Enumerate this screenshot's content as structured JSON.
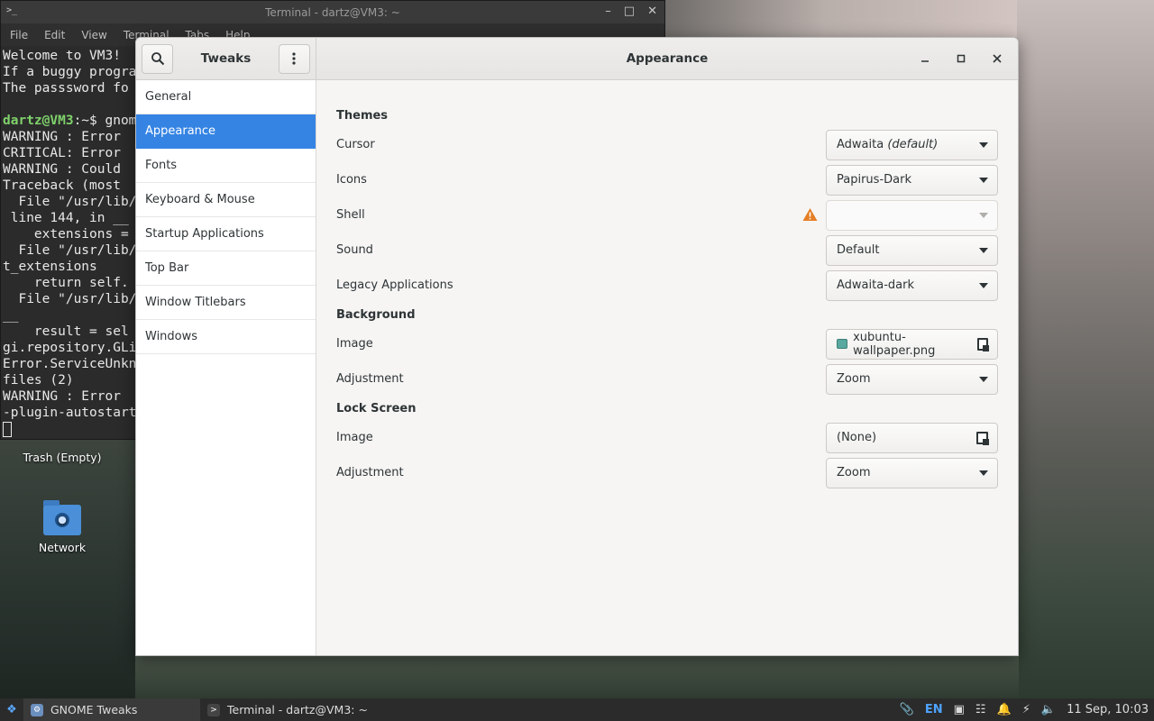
{
  "terminal": {
    "title": "Terminal - dartz@VM3: ~",
    "menu": [
      "File",
      "Edit",
      "View",
      "Terminal",
      "Tabs",
      "Help"
    ],
    "lines": [
      {
        "text": "Welcome to VM3!"
      },
      {
        "text": "If a buggy progra"
      },
      {
        "text": "The passsword fo"
      },
      {
        "text": ""
      },
      {
        "prompt": "dartz@VM3",
        "text": ":~$ gnom"
      },
      {
        "text": "WARNING : Error"
      },
      {
        "text": "CRITICAL: Error"
      },
      {
        "text": "WARNING : Could"
      },
      {
        "text": "Traceback (most"
      },
      {
        "text": "  File \"/usr/lib/"
      },
      {
        "text": " line 144, in __"
      },
      {
        "text": "    extensions ="
      },
      {
        "text": "  File \"/usr/lib/"
      },
      {
        "text": "t_extensions"
      },
      {
        "text": "    return self."
      },
      {
        "text": "  File \"/usr/lib/"
      },
      {
        "text": "__"
      },
      {
        "text": "    result = sel"
      },
      {
        "text": "gi.repository.GLi"
      },
      {
        "text": "Error.ServiceUnkn"
      },
      {
        "text": "files (2)"
      },
      {
        "text": "WARNING : Error"
      },
      {
        "text": "-plugin-autostart"
      }
    ]
  },
  "desktop": {
    "trash_label": "Trash (Empty)",
    "network_label": "Network"
  },
  "tweaks": {
    "sidebar_title": "Tweaks",
    "main_title": "Appearance",
    "sidebar_items": [
      {
        "label": "General",
        "active": false
      },
      {
        "label": "Appearance",
        "active": true
      },
      {
        "label": "Fonts",
        "active": false
      },
      {
        "label": "Keyboard & Mouse",
        "active": false
      },
      {
        "label": "Startup Applications",
        "active": false
      },
      {
        "label": "Top Bar",
        "active": false
      },
      {
        "label": "Window Titlebars",
        "active": false
      },
      {
        "label": "Windows",
        "active": false
      }
    ],
    "themes": {
      "title": "Themes",
      "cursor_label": "Cursor",
      "cursor_value": "Adwaita",
      "cursor_suffix": "(default)",
      "icons_label": "Icons",
      "icons_value": "Papirus-Dark",
      "shell_label": "Shell",
      "shell_value": "",
      "sound_label": "Sound",
      "sound_value": "Default",
      "legacy_label": "Legacy Applications",
      "legacy_value": "Adwaita-dark"
    },
    "background": {
      "title": "Background",
      "image_label": "Image",
      "image_value": "xubuntu-wallpaper.png",
      "adjustment_label": "Adjustment",
      "adjustment_value": "Zoom"
    },
    "lock_screen": {
      "title": "Lock Screen",
      "image_label": "Image",
      "image_value": "(None)",
      "adjustment_label": "Adjustment",
      "adjustment_value": "Zoom"
    }
  },
  "taskbar": {
    "tasks": [
      {
        "label": "GNOME Tweaks",
        "active": true
      },
      {
        "label": "Terminal - dartz@VM3: ~",
        "active": false
      }
    ],
    "lang": "EN",
    "clock": "11 Sep, 10:03"
  },
  "colors": {
    "accent": "#3584e4",
    "warning": "#e57e25"
  }
}
